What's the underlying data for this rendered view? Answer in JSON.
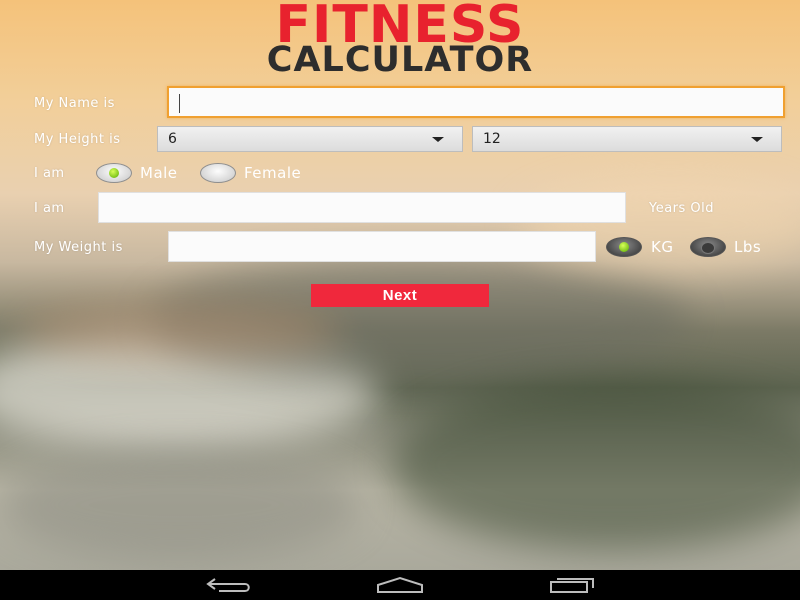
{
  "logo": {
    "line1": "FITNESS",
    "line2": "CALCULATOR"
  },
  "form": {
    "name_label": "My Name is",
    "name_value": "",
    "height_label": "My Height is",
    "height_feet": "6",
    "height_inches": "12",
    "gender_label": "I am",
    "male_label": "Male",
    "female_label": "Female",
    "selected_gender": "Male",
    "age_label": "I am",
    "age_value": "",
    "age_suffix": "Years Old",
    "weight_label": "My Weight is",
    "weight_value": "",
    "kg_label": "KG",
    "lbs_label": "Lbs",
    "selected_unit": "KG",
    "next_label": "Next"
  },
  "nav": {
    "icons": [
      "back-icon",
      "home-icon",
      "recent-apps-icon"
    ]
  },
  "colors": {
    "accent_red": "#f0283c",
    "logo_red": "#e8222e",
    "focus_orange": "#f0a030",
    "radio_green": "#7dc41a"
  }
}
